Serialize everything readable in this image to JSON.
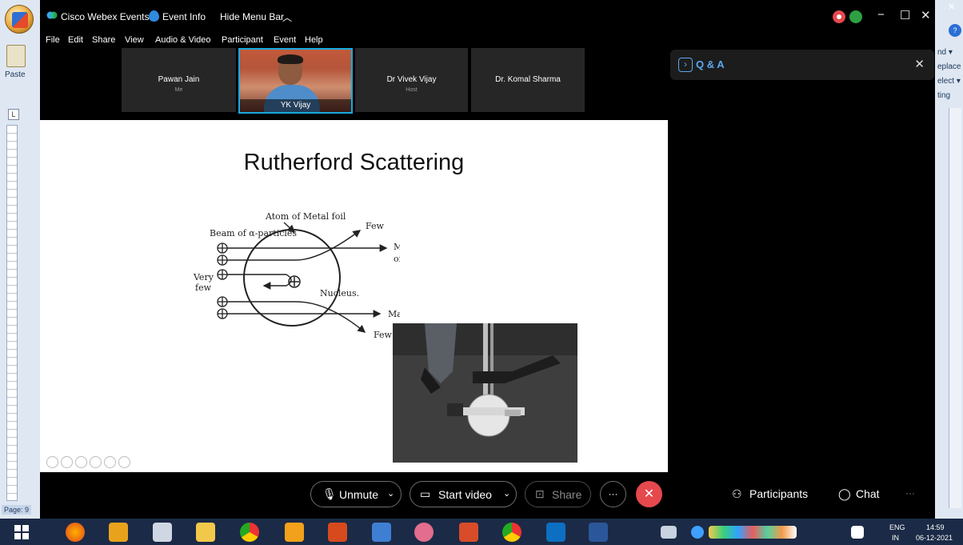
{
  "window": {
    "app_title": "Cisco Webex Events",
    "event_info": "Event Info",
    "hide_menu_bar": "Hide Menu Bar"
  },
  "menu": [
    "File",
    "Edit",
    "Share",
    "View",
    "Audio & Video",
    "Participant",
    "Event",
    "Help"
  ],
  "participants": [
    {
      "name": "Pawan Jain",
      "role": "Me"
    },
    {
      "name": "YK Vijay",
      "role": ""
    },
    {
      "name": "Dr Vivek Vijay",
      "role": "Host"
    },
    {
      "name": "Dr. Komal Sharma",
      "role": ""
    }
  ],
  "qa_panel": {
    "label": "Q & A"
  },
  "slide": {
    "title": "Rutherford Scattering",
    "labels": {
      "atom": "Atom of Metal foil",
      "beam": "Beam of α-particles",
      "few_top": "Few",
      "majority_top_1": "Majority",
      "majority_top_2": "of α-rays",
      "very_1": "Very",
      "very_2": "few",
      "nucleus": "Nucleus.",
      "majority_bottom": "Majority",
      "few_bottom": "Few"
    }
  },
  "toolbar": {
    "unmute": "Unmute",
    "start_video": "Start video",
    "share": "Share",
    "more": "···",
    "participants": "Participants",
    "chat": "Chat",
    "overflow": "···"
  },
  "word": {
    "paste": "Paste",
    "page": "Page: 9",
    "right_labels": [
      "nd ▾",
      "eplace",
      "elect ▾",
      "ting"
    ]
  },
  "taskbar": {
    "lang_1": "ENG",
    "lang_2": "IN",
    "time": "14:59",
    "date": "06-12-2021"
  },
  "colors": {
    "accent_blue": "#19a9e0",
    "end_call_red": "#e5484d",
    "qa_blue": "#5aa8f0"
  }
}
